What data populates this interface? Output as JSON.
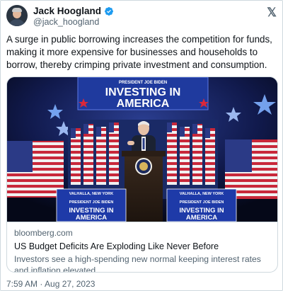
{
  "author": {
    "display_name": "Jack Hoogland",
    "handle": "@jack_hoogland",
    "verified": true,
    "avatar_icon": "profile-photo"
  },
  "header": {
    "platform_icon": "x-logo-icon",
    "platform_glyph": "𝕏"
  },
  "tweet": {
    "text": "A surge in public borrowing increases the competition for funds, making it more expensive for businesses and households to borrow, thereby crimping private investment and consumption.",
    "timestamp": "7:59 AM · Aug 27, 2023"
  },
  "card": {
    "image": {
      "banner_small": "PRESIDENT JOE BIDEN",
      "banner_main_line1": "INVESTING IN",
      "banner_main_line2": "AMERICA",
      "sign_left": {
        "line1": "VALHALLA, NEW YORK",
        "line2": "PRESIDENT JOE BIDEN",
        "line3": "INVESTING IN",
        "line4": "AMERICA"
      },
      "sign_right": {
        "line1": "VALHALLA, NEW YORK",
        "line2": "PRESIDENT JOE BIDEN",
        "line3": "INVESTING IN",
        "line4": "AMERICA"
      }
    },
    "domain": "bloomberg.com",
    "title": "US Budget Deficits Are Exploding Like Never Before",
    "description": "Investors see a high-spending new normal keeping interest rates and inflation elevated."
  },
  "colors": {
    "verified_blue": "#1d9bf0",
    "text_primary": "#0f1419",
    "text_secondary": "#536471",
    "border": "#cfd9de"
  }
}
